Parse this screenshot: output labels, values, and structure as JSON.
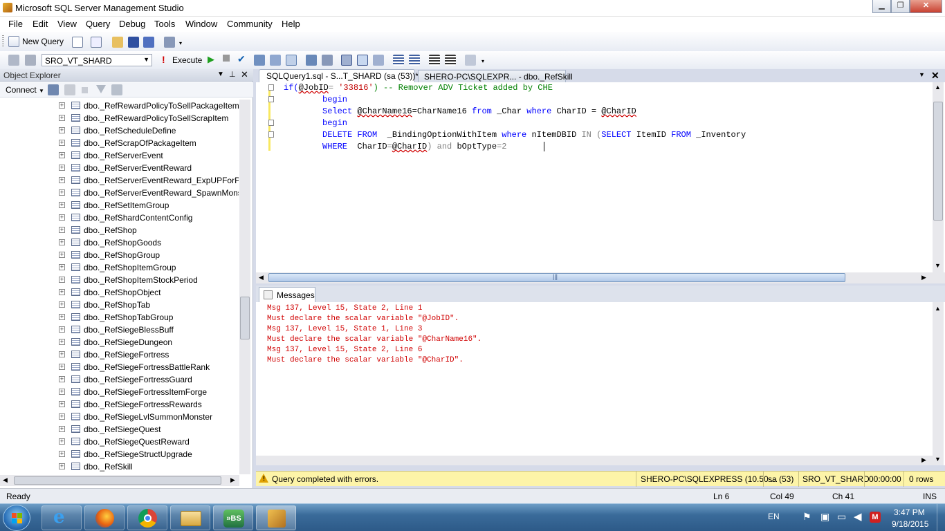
{
  "window": {
    "title": "Microsoft SQL Server Management Studio"
  },
  "menu": [
    "File",
    "Edit",
    "View",
    "Query",
    "Debug",
    "Tools",
    "Window",
    "Community",
    "Help"
  ],
  "toolbar": {
    "new_query": "New Query",
    "database": "SRO_VT_SHARD",
    "execute": "Execute"
  },
  "object_explorer": {
    "title": "Object Explorer",
    "connect": "Connect",
    "items": [
      "dbo._RefRewardPolicyToSellPackageItem",
      "dbo._RefRewardPolicyToSellScrapItem",
      "dbo._RefScheduleDefine",
      "dbo._RefScrapOfPackageItem",
      "dbo._RefServerEvent",
      "dbo._RefServerEventReward",
      "dbo._RefServerEventReward_ExpUPForPlay",
      "dbo._RefServerEventReward_SpawnMonste",
      "dbo._RefSetItemGroup",
      "dbo._RefShardContentConfig",
      "dbo._RefShop",
      "dbo._RefShopGoods",
      "dbo._RefShopGroup",
      "dbo._RefShopItemGroup",
      "dbo._RefShopItemStockPeriod",
      "dbo._RefShopObject",
      "dbo._RefShopTab",
      "dbo._RefShopTabGroup",
      "dbo._RefSiegeBlessBuff",
      "dbo._RefSiegeDungeon",
      "dbo._RefSiegeFortress",
      "dbo._RefSiegeFortressBattleRank",
      "dbo._RefSiegeFortressGuard",
      "dbo._RefSiegeFortressItemForge",
      "dbo._RefSiegeFortressRewards",
      "dbo._RefSiegeLvlSummonMonster",
      "dbo._RefSiegeQuest",
      "dbo._RefSiegeQuestReward",
      "dbo._RefSiegeStructUpgrade",
      "dbo._RefSkill"
    ]
  },
  "tabs": {
    "active": "SQLQuery1.sql - S...T_SHARD (sa (53))*",
    "inactive": "SHERO-PC\\SQLEXPR... - dbo._RefSkill"
  },
  "code": {
    "l1": {
      "a": "if(",
      "b": "@JobID",
      "c": "= ",
      "d": "'33816'",
      "e": ") -- Remover ADV Ticket added by CHE"
    },
    "l2": "begin",
    "l3": {
      "a": "Select ",
      "b": "@CharName16",
      "c": "=CharName16 ",
      "d": "from",
      "e": " _Char ",
      "f": "where",
      "g": " CharID = ",
      "h": "@CharID"
    },
    "l4": "begin",
    "l5": {
      "a": "DELETE FROM",
      "b": "  _BindingOptionWithItem ",
      "c": "where",
      "d": " nItemDBID ",
      "e": "IN (",
      "f": "SELECT",
      "g": " ItemID ",
      "h": "FROM",
      "i": " _Inventory"
    },
    "l6": {
      "a": "WHERE",
      "b": "  CharID",
      "c": "=",
      "d": "@CharID",
      "e": ") ",
      "f": "and",
      "g": " bOptType",
      "h": "=2"
    }
  },
  "messages": {
    "tab": "Messages",
    "lines": [
      "Msg 137, Level 15, State 2, Line 1",
      "Must declare the scalar variable \"@JobID\".",
      "Msg 137, Level 15, State 1, Line 3",
      "Must declare the scalar variable \"@CharName16\".",
      "Msg 137, Level 15, State 2, Line 6",
      "Must declare the scalar variable \"@CharID\"."
    ]
  },
  "query_status": {
    "text": "Query completed with errors.",
    "server": "SHERO-PC\\SQLEXPRESS (10.50 ...",
    "user": "sa (53)",
    "db": "SRO_VT_SHARD",
    "time": "00:00:00",
    "rows": "0 rows"
  },
  "statusbar": {
    "ready": "Ready",
    "ln": "Ln 6",
    "col": "Col 49",
    "ch": "Ch 41",
    "mode": "INS"
  },
  "taskbar": {
    "lang": "EN",
    "time": "3:47 PM",
    "date": "9/18/2015"
  },
  "colors": {
    "keyword": "#0000ff",
    "string": "#c00000",
    "comment": "#008000",
    "error": "#d00000",
    "status_yellow": "#fdf4a8"
  }
}
